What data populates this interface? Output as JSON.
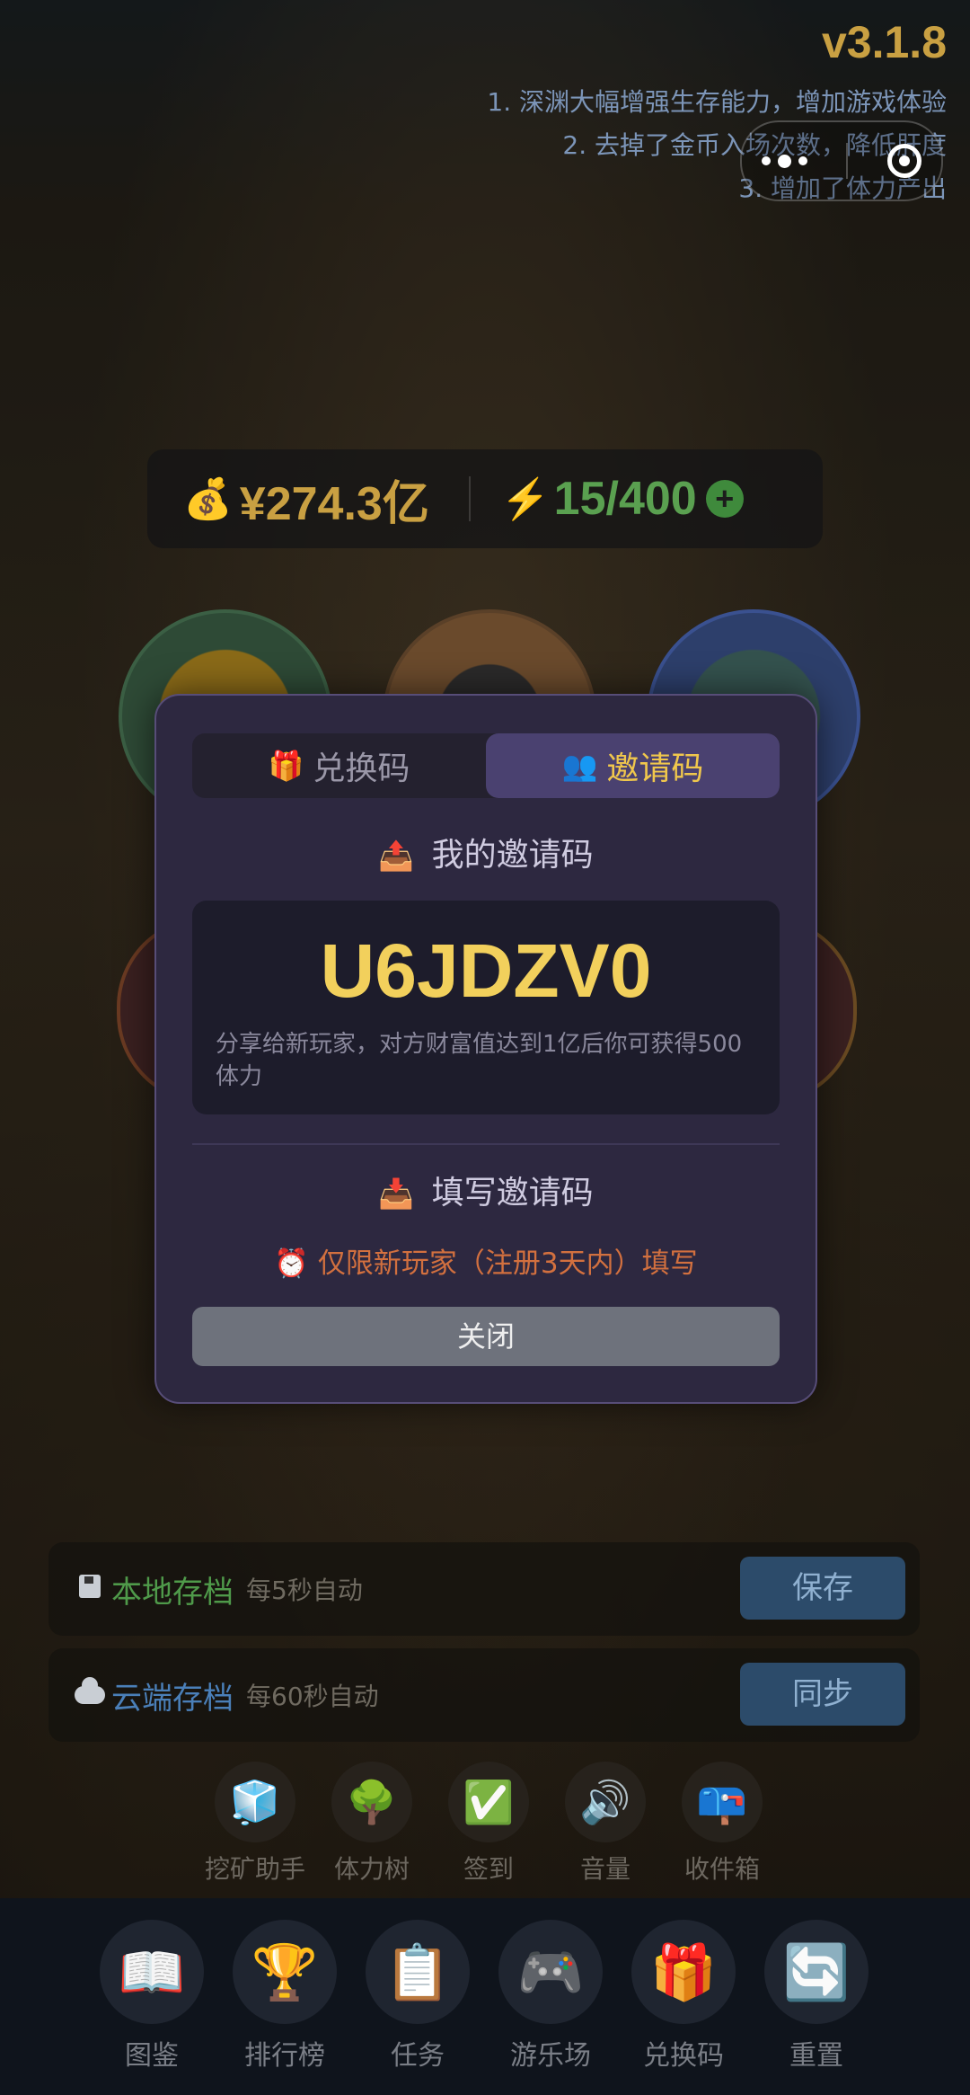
{
  "header": {
    "version": "v3.1.8",
    "notes": [
      "1. 深渊大幅增强生存能力，增加游戏体验",
      "2. 去掉了金币入场次数，降低肝度",
      "3. 增加了体力产出"
    ]
  },
  "resources": {
    "money_icon": "money-bag-icon",
    "money": "¥274.3亿",
    "energy_icon": "lightning-icon",
    "energy": "15/400",
    "energy_plus": "+"
  },
  "modal": {
    "tabs": [
      {
        "label": "兑换码",
        "icon": "gift-icon",
        "emoji": "🎁"
      },
      {
        "label": "邀请码",
        "icon": "people-icon",
        "emoji": "👥"
      }
    ],
    "my_code_title": "我的邀请码",
    "my_code_icon": "📤",
    "code": "U6JDZV0",
    "code_desc": "分享给新玩家，对方财富值达到1亿后你可获得500 体力",
    "fill_title": "填写邀请码",
    "fill_icon": "📥",
    "limit_icon": "⏰",
    "limit_text": "仅限新玩家（注册3天内）填写",
    "close_label": "关闭"
  },
  "saves": {
    "local": {
      "title": "本地存档",
      "sub": "每5秒自动",
      "button": "保存",
      "title_color": "#4f9a4a"
    },
    "cloud": {
      "title": "云端存档",
      "sub": "每60秒自动",
      "button": "同步",
      "title_color": "#4a7fb8"
    }
  },
  "tools": [
    {
      "label": "挖矿助手",
      "emoji": "🧊"
    },
    {
      "label": "体力树",
      "emoji": "🌳"
    },
    {
      "label": "签到",
      "emoji": "✅"
    },
    {
      "label": "音量",
      "emoji": "🔊"
    },
    {
      "label": "收件箱",
      "emoji": "📪"
    }
  ],
  "nav": [
    {
      "label": "图鉴",
      "emoji": "📖"
    },
    {
      "label": "排行榜",
      "emoji": "🏆"
    },
    {
      "label": "任务",
      "emoji": "📋"
    },
    {
      "label": "游乐场",
      "emoji": "🎮"
    },
    {
      "label": "兑换码",
      "emoji": "🎁"
    },
    {
      "label": "重置",
      "emoji": "🔄"
    }
  ]
}
